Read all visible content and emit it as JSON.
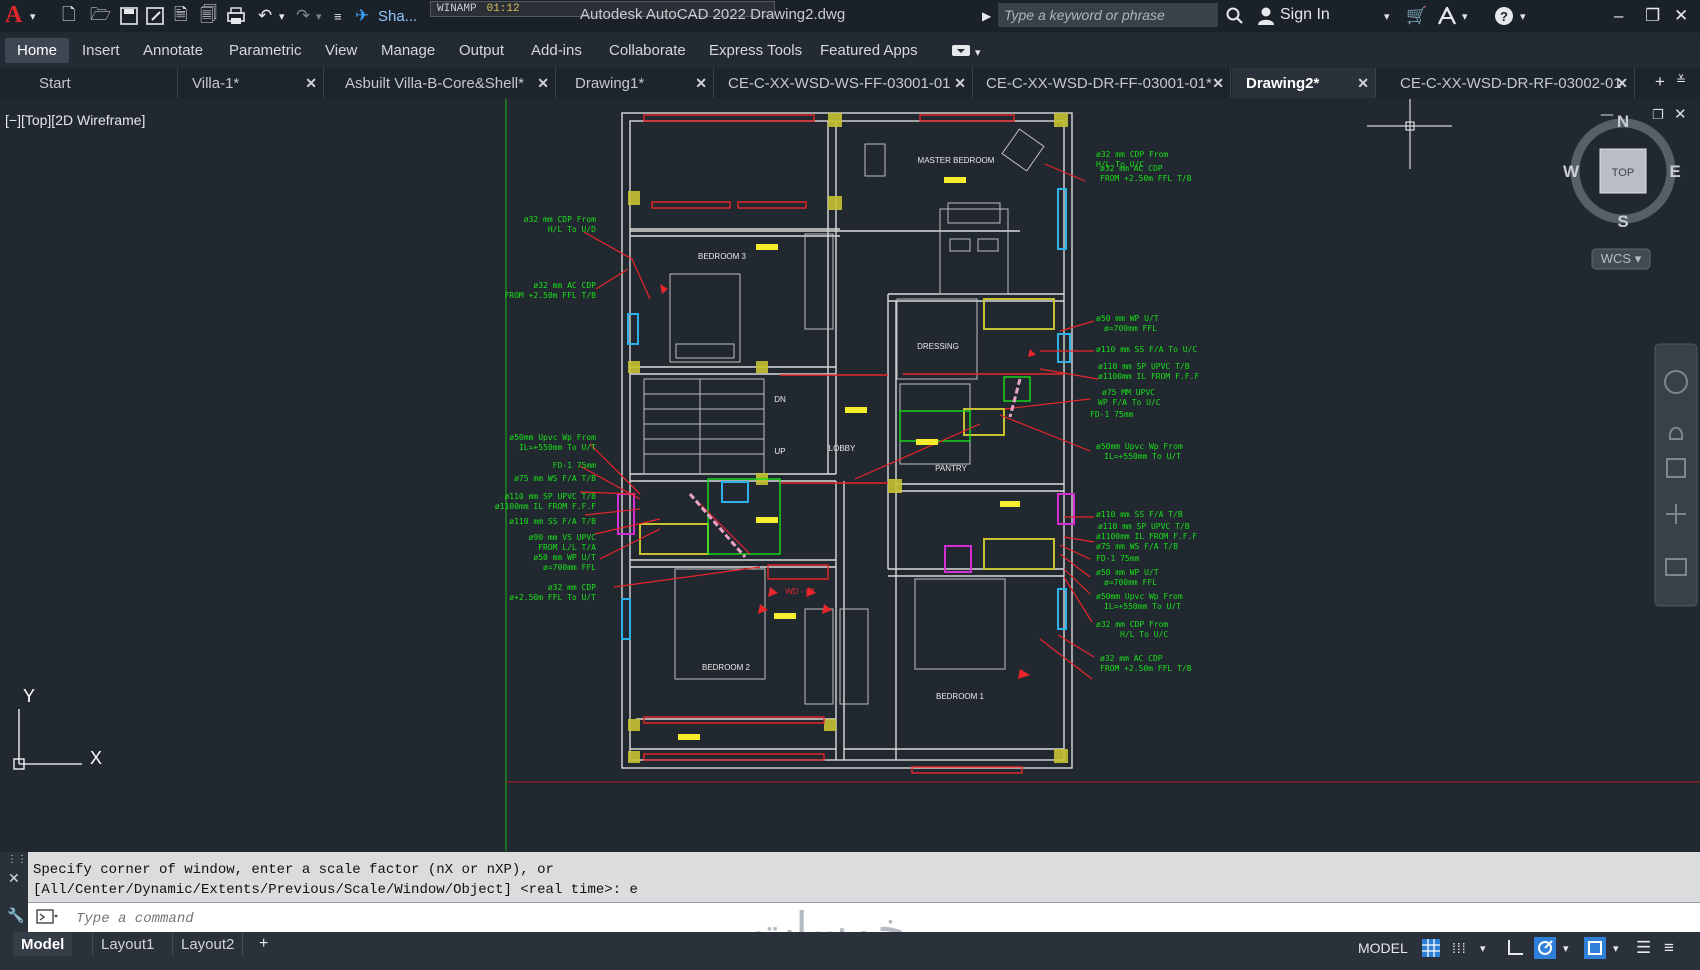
{
  "app": {
    "logo": "A",
    "document_title": "Autodesk AutoCAD 2022  Drawing2.dwg",
    "share_label": "Sha...",
    "search_placeholder": "Type a keyword or phrase",
    "sign_in": "Sign In"
  },
  "winamp": {
    "name": "WINAMP",
    "time": "01:12"
  },
  "ribbon_tabs": [
    "Home",
    "Insert",
    "Annotate",
    "Parametric",
    "View",
    "Manage",
    "Output",
    "Add-ins",
    "Collaborate",
    "Express Tools",
    "Featured Apps"
  ],
  "file_tabs": [
    "Start",
    "Villa-1*",
    "Asbuilt Villa-B-Core&Shell*",
    "Drawing1*",
    "CE-C-XX-WSD-WS-FF-03001-01",
    "CE-C-XX-WSD-DR-FF-03001-01*",
    "Drawing2*",
    "CE-C-XX-WSD-DR-RF-03002-01"
  ],
  "viewport": {
    "label": "[−][Top][2D Wireframe]",
    "viewcube": {
      "top": "TOP",
      "n": "N",
      "s": "S",
      "e": "E",
      "w": "W",
      "wcs": "WCS ▾"
    },
    "ucs": {
      "x": "X",
      "y": "Y"
    }
  },
  "drawing": {
    "rooms": [
      "MASTER BEDROOM",
      "BEDROOM 3",
      "DRESSING",
      "LOBBY",
      "PANTRY",
      "BEDROOM 2",
      "BEDROOM 1",
      "DN",
      "UP",
      "WD - 03"
    ],
    "notes_left": [
      "ø32 mm CDP From",
      "H/L To U/D",
      "ø32 mm AC CDP",
      "FROM +2.50m FFL T/B",
      "ø50mm Upvc Wp From",
      "IL=+550mm To U/T",
      "FD-1  75mm",
      "ø75 mm WS F/A T/B",
      "ø110 mm SP UPVC T/B",
      "ø1100mm IL FROM F.F.F",
      "ø110 mm SS F/A T/B",
      "ø90 mm VS UPVC",
      "FROM L/L T/A",
      "ø50 mm WP U/T",
      "ø=700mm FFL",
      "ø32 mm CDP",
      "ø+2.50m FFL To U/T"
    ],
    "notes_right": [
      "ø32 mm CDP From",
      "H/L To U/C",
      "ø32 mm AC CDP",
      "FROM +2.50m FFL T/B",
      "ø50 mm WP U/T",
      "ø=700mm FFL",
      "ø110 mm SS F/A To U/C",
      "ø110 mm SP UPVC T/B",
      "ø1100mm IL FROM F.F.F",
      "ø75 MM UPVC",
      "WP F/A To U/C",
      "FD-1  75mm",
      "ø50mm Upvc Wp From",
      "IL=+550mm To U/T",
      "ø110 mm SS F/A T/B",
      "ø110 mm SP UPVC T/B",
      "ø1100mm IL FROM F.F.F",
      "ø75 mm WS F/A T/B",
      "FD-1  75mm",
      "ø50 mm WP U/T",
      "ø=700mm FFL",
      "ø50mm Upvc Wp From",
      "IL=+550mm To U/T",
      "ø32 mm CDP From",
      "H/L To U/C",
      "ø32 mm AC CDP",
      "FROM +2.50m FFL T/B"
    ]
  },
  "command": {
    "history_1": "Specify corner of window, enter a scale factor (nX or nXP), or",
    "history_2": "[All/Center/Dynamic/Extents/Previous/Scale/Window/Object] <real time>: e",
    "placeholder": "Type a command"
  },
  "watermark": "خمسات",
  "layout_tabs": [
    "Model",
    "Layout1",
    "Layout2"
  ],
  "status": {
    "model": "MODEL"
  },
  "colors": {
    "accent_red": "#e0262b",
    "line_green": "#19e019",
    "wall_white": "#d9d9d9",
    "hatch_yellow": "#c7c133",
    "pipe_red": "#e8262b"
  }
}
